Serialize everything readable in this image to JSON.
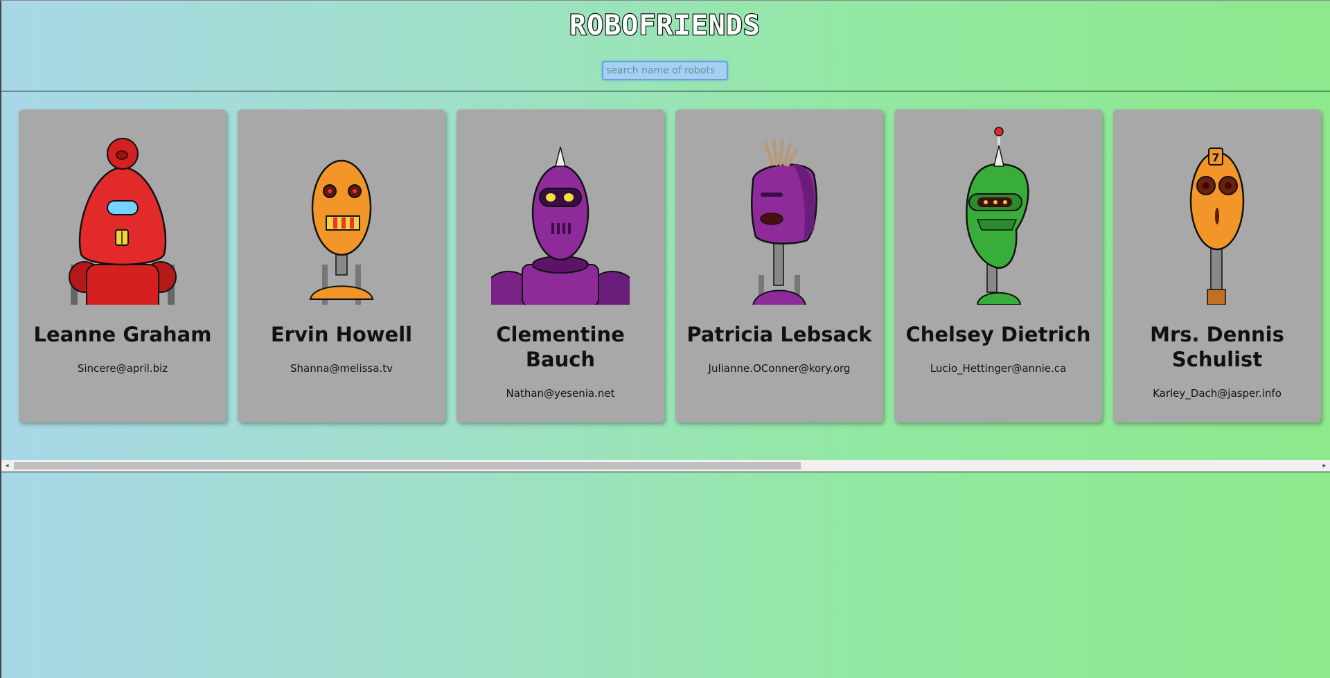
{
  "header": {
    "title": "ROBOFRIENDS",
    "search_placeholder": "search name of robots"
  },
  "robots": [
    {
      "name": "Leanne Graham",
      "email": "Sincere@april.biz",
      "color": "#e32a2a"
    },
    {
      "name": "Ervin Howell",
      "email": "Shanna@melissa.tv",
      "color": "#f2962a"
    },
    {
      "name": "Clementine Bauch",
      "email": "Nathan@yesenia.net",
      "color": "#8e2a9a"
    },
    {
      "name": "Patricia Lebsack",
      "email": "Julianne.OConner@kory.org",
      "color": "#8e2a9a"
    },
    {
      "name": "Chelsey Dietrich",
      "email": "Lucio_Hettinger@annie.ca",
      "color": "#38ad3a"
    },
    {
      "name": "Mrs. Dennis Schulist",
      "email": "Karley_Dach@jasper.info",
      "color": "#f2962a"
    }
  ],
  "scrollbar": {
    "left_arrow": "◂",
    "right_arrow": "▸"
  }
}
